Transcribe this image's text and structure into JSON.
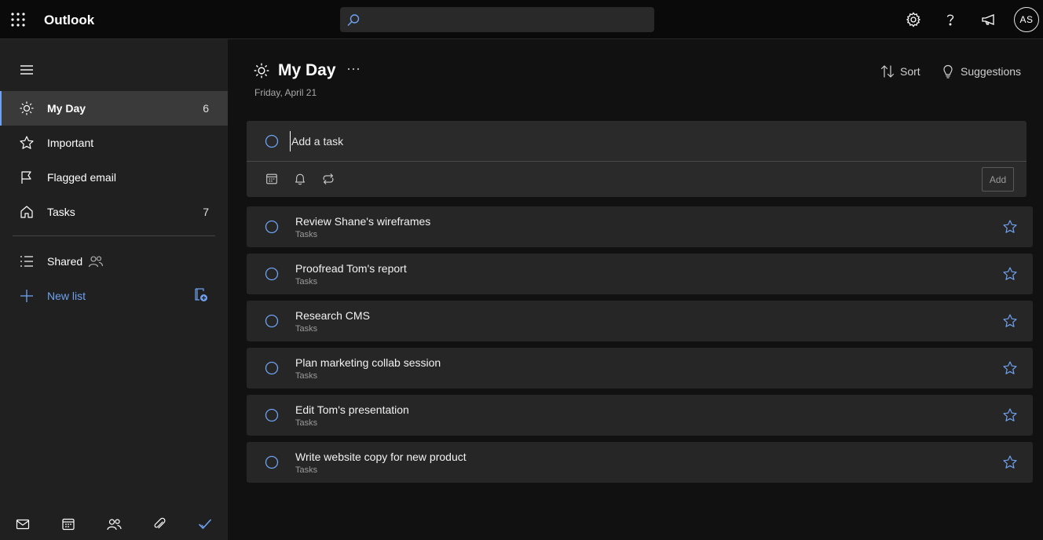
{
  "app": {
    "title": "Outlook",
    "user_initials": "AS"
  },
  "search": {
    "placeholder": ""
  },
  "colors": {
    "accent": "#6ea2f0",
    "background": "#111111",
    "sidebar": "#202020",
    "card": "#262626"
  },
  "sidebar": {
    "items": [
      {
        "label": "My Day",
        "count": "6",
        "icon": "sun-icon",
        "active": true
      },
      {
        "label": "Important",
        "count": "",
        "icon": "star-icon"
      },
      {
        "label": "Flagged email",
        "count": "",
        "icon": "flag-icon"
      },
      {
        "label": "Tasks",
        "count": "7",
        "icon": "home-icon"
      }
    ],
    "shared_label": "Shared",
    "new_list_label": "New list",
    "bottom_icons": [
      "mail-icon",
      "calendar-icon",
      "people-icon",
      "attachment-icon",
      "todo-check-icon"
    ]
  },
  "main": {
    "title": "My Day",
    "date": "Friday, April 21",
    "sort_label": "Sort",
    "suggestions_label": "Suggestions",
    "add_task": {
      "placeholder": "Add a task",
      "add_button": "Add"
    },
    "tasks": [
      {
        "title": "Review Shane's wireframes",
        "list": "Tasks"
      },
      {
        "title": "Proofread Tom's report",
        "list": "Tasks"
      },
      {
        "title": "Research CMS",
        "list": "Tasks"
      },
      {
        "title": "Plan marketing collab session",
        "list": "Tasks"
      },
      {
        "title": "Edit Tom's presentation",
        "list": "Tasks"
      },
      {
        "title": "Write website copy for new product",
        "list": "Tasks"
      }
    ]
  }
}
